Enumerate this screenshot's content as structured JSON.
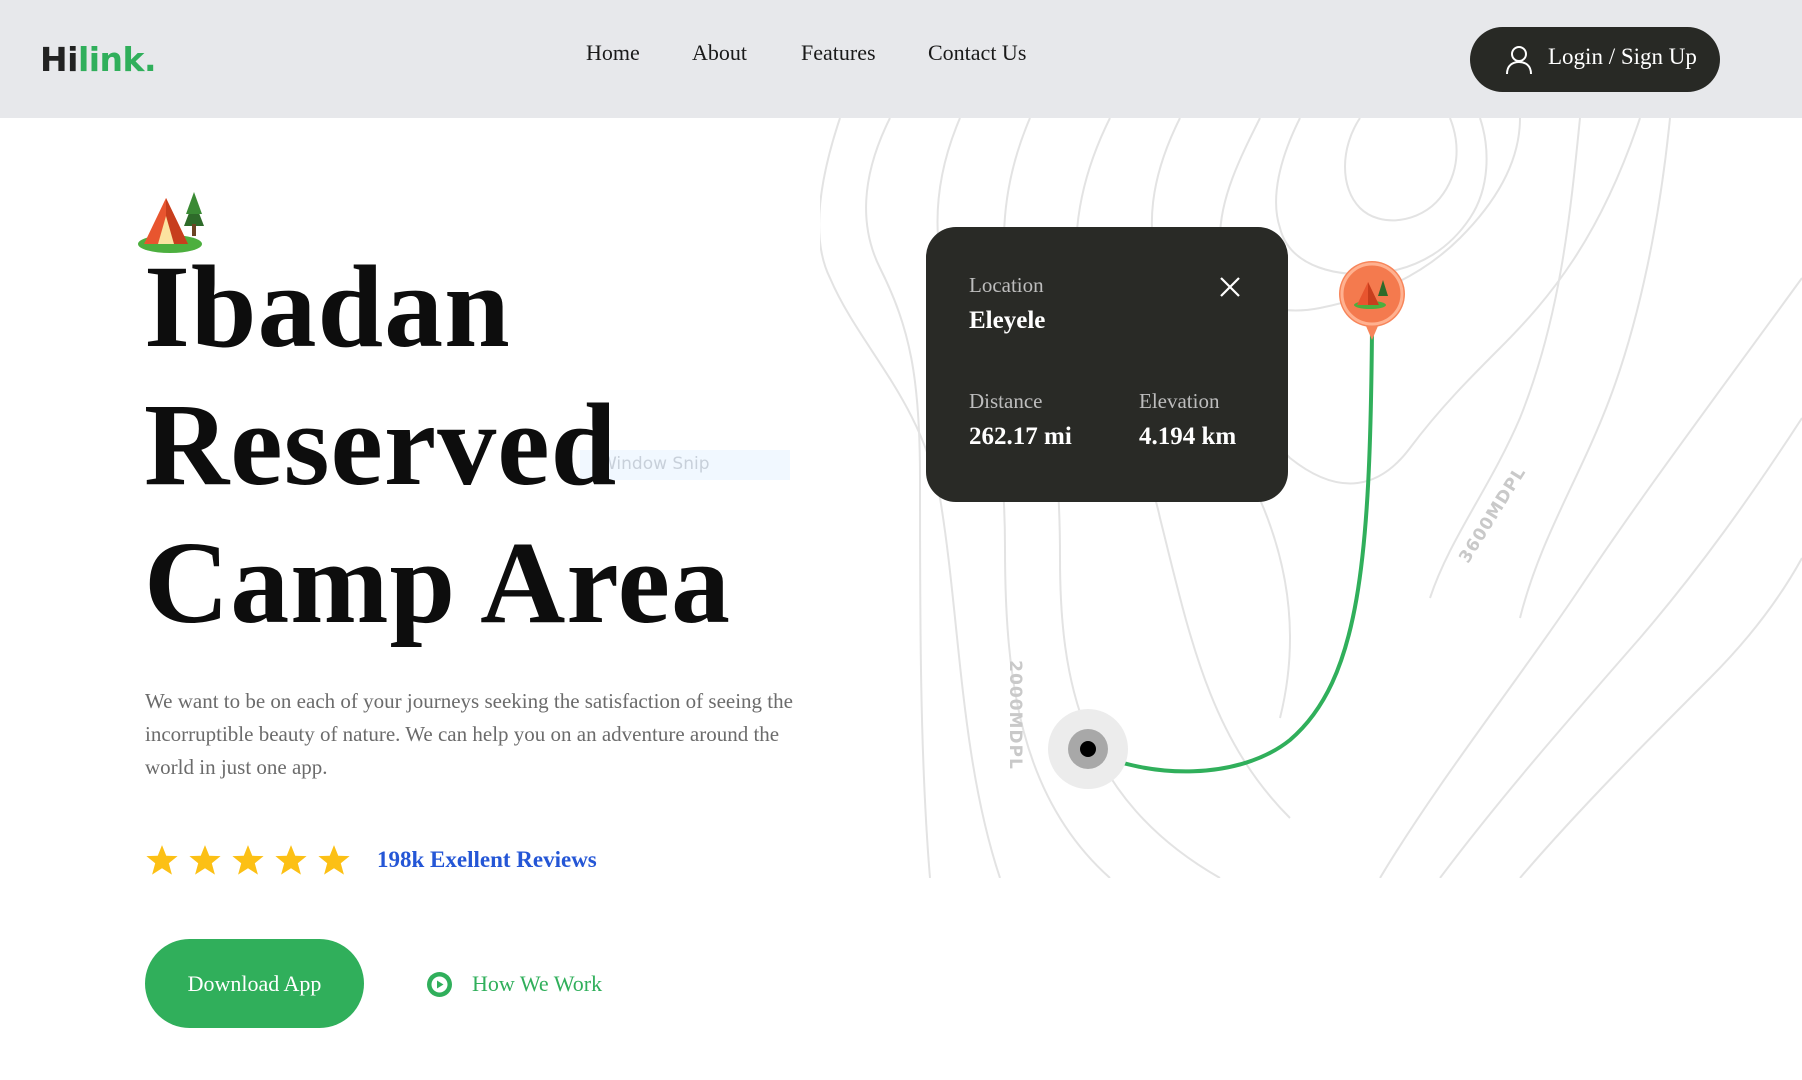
{
  "brand": {
    "logo_hi": "Hi",
    "logo_link": "link",
    "logo_dot": ".",
    "accent": "#30af5b",
    "dark": "#292a26"
  },
  "nav": {
    "items": [
      {
        "label": "Home"
      },
      {
        "label": "About"
      },
      {
        "label": "Features"
      },
      {
        "label": "Contact Us"
      }
    ],
    "login_label": "Login / Sign Up",
    "login_icon": "user-icon"
  },
  "hero": {
    "title_lines": [
      "Ibadan",
      "Reserved",
      "Camp Area"
    ],
    "tent_icon": "camping-tent-icon",
    "description": "We want to be on each of your journeys seeking the satisfaction of seeing the incorruptible beauty of nature. We can help you on an adventure around the world in just one app.",
    "rating": {
      "stars": 5,
      "max": 5,
      "color": "#fcc015"
    },
    "reviews_label": "198k Exellent Reviews",
    "download_label": "Download App",
    "how_label": "How We Work",
    "how_icon": "play-icon"
  },
  "overlay_text": "Window Snip",
  "map": {
    "contour_labels": [
      "2000MDPL",
      "3600MDPL"
    ],
    "card": {
      "location_label": "Location",
      "location_value": "Eleyele",
      "distance_label": "Distance",
      "distance_value": "262.17 mi",
      "elevation_label": "Elevation",
      "elevation_value": "4.194 km",
      "close_icon": "close-icon"
    },
    "route_color": "#30af5b",
    "destination_pin_color": "#f7855a"
  }
}
